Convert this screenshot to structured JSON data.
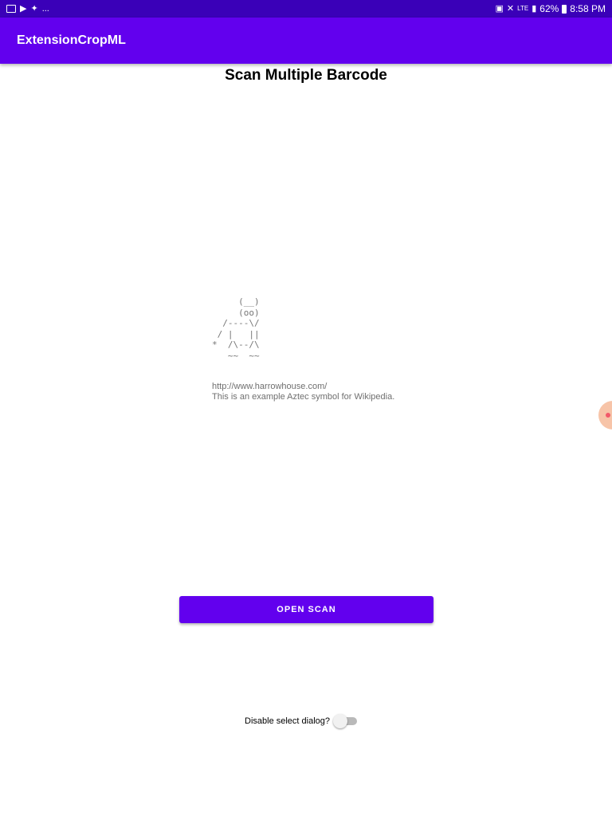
{
  "status_bar": {
    "overflow": "...",
    "network": "LTE",
    "battery": "62%",
    "time": "8:58 PM"
  },
  "app_bar": {
    "title": "ExtensionCropML"
  },
  "page": {
    "title": "Scan Multiple Barcode"
  },
  "result": {
    "ascii_art": [
      "     (__)",
      "     (oo)",
      "  /----\\/",
      " / |   ||",
      "*  /\\--/\\",
      "   ~~  ~~"
    ],
    "url": "http://www.harrowhouse.com/",
    "description": "This is an example Aztec symbol for Wikipedia."
  },
  "scan_button": {
    "label": "OPEN SCAN"
  },
  "dialog_toggle": {
    "label": "Disable select dialog?",
    "checked": false
  },
  "colors": {
    "primary": "#6200ee",
    "status_bar": "#3a00b8"
  }
}
